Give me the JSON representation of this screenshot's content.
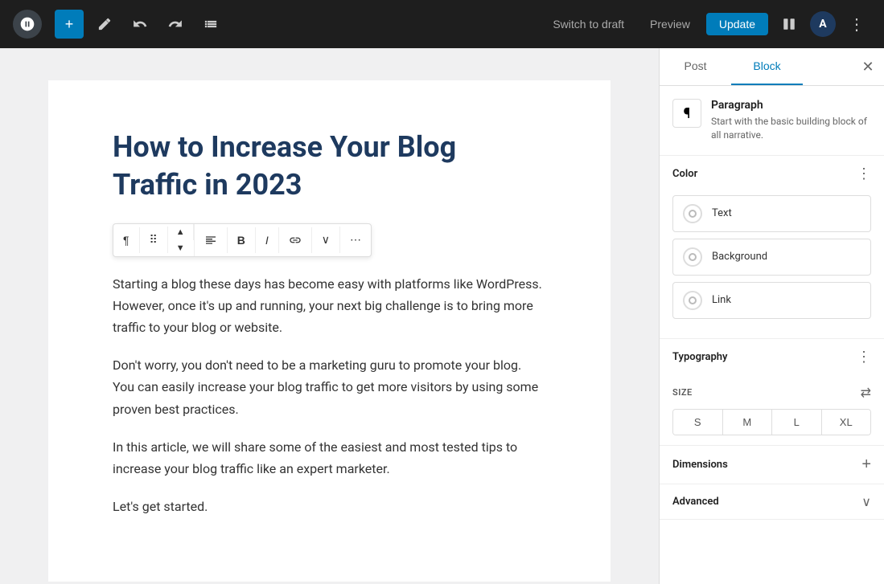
{
  "toolbar": {
    "add_label": "+",
    "undo_label": "↩",
    "redo_label": "↪",
    "list_label": "≡",
    "switch_draft": "Switch to draft",
    "preview": "Preview",
    "update": "Update",
    "astra_label": "A"
  },
  "post": {
    "title": "How to Increase Your Blog Traffic in 2023",
    "paragraph1": "Starting a blog these days has become easy with platforms like WordPress. However, once it's up and running, your next big challenge is to bring more traffic to your blog or website.",
    "paragraph2": "Don't worry, you don't need to be a marketing guru to promote your blog. You can easily increase your blog traffic to get more visitors by using some proven best practices.",
    "paragraph3": "In this article, we will share some of the easiest and most tested tips to increase your blog traffic like an expert marketer.",
    "paragraph4": "Let's get started."
  },
  "inline_toolbar": {
    "paragraph_icon": "¶",
    "drag_icon": "⠿",
    "move_up": "↑",
    "move_down": "↓",
    "align": "≡",
    "bold": "B",
    "italic": "I",
    "link": "🔗",
    "more": "⋯",
    "dropdown": "∨"
  },
  "sidebar": {
    "tab_post": "Post",
    "tab_block": "Block",
    "active_tab": "block",
    "block_info": {
      "icon": "¶",
      "title": "Paragraph",
      "description": "Start with the basic building block of all narrative."
    },
    "color_section": {
      "title": "Color",
      "options": [
        {
          "label": "Text"
        },
        {
          "label": "Background"
        },
        {
          "label": "Link"
        }
      ]
    },
    "typography_section": {
      "title": "Typography",
      "size_label": "SIZE",
      "sizes": [
        "S",
        "M",
        "L",
        "XL"
      ]
    },
    "dimensions_section": {
      "title": "Dimensions"
    },
    "advanced_section": {
      "title": "Advanced"
    }
  }
}
